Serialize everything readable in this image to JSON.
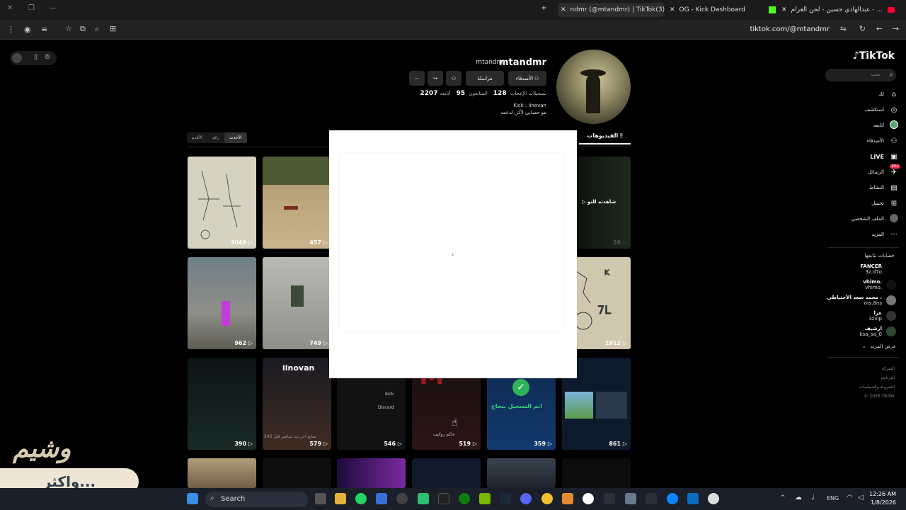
{
  "browser": {
    "tabs": [
      {
        "label": "عبدالهادي حسين - لحن الغرام - ..."
      },
      {
        "label": "OG - Kick Dashboard"
      },
      {
        "label": "ndmr (@mtandmr) | TikTok(3)"
      }
    ],
    "url": "tiktok.com/@mtandmr"
  },
  "sidebar": {
    "logo": "TikTok",
    "search_placeholder": "بحث",
    "items": [
      {
        "label": "لك",
        "icon": "home-icon"
      },
      {
        "label": "استكشف",
        "icon": "compass-icon"
      },
      {
        "label": "أتابعه",
        "icon": "following-avatar-icon"
      },
      {
        "label": "الأصدقاء",
        "icon": "friends-icon"
      },
      {
        "label": "LIVE",
        "icon": "live-icon"
      },
      {
        "label": "الرسائل",
        "icon": "messages-icon",
        "badge": "99+"
      },
      {
        "label": "النشاط",
        "icon": "activity-icon"
      },
      {
        "label": "تحميل",
        "icon": "upload-icon"
      },
      {
        "label": "الملف الشخصي",
        "icon": "profile-icon"
      },
      {
        "label": "المزيد",
        "icon": "more-icon"
      }
    ],
    "following_header": "حسابات تتابعها",
    "following": [
      {
        "name": "FANCER",
        "handle": "3z.d7o"
      },
      {
        "name": "vhimo.",
        "handle": "vhimo."
      },
      {
        "name": "محمد سعد الأحتياطي .",
        "handle": "ms.8ns"
      },
      {
        "name": "عزا",
        "handle": "3zvip"
      },
      {
        "name": "ارشيف",
        "handle": "ksa_sa_0"
      }
    ],
    "show_more": "عرض المزيد",
    "footer": [
      "الشركة",
      "البرنامج",
      "الشروط والسياسات",
      "© 2026 TikTok"
    ]
  },
  "profile": {
    "username": "mtandmr",
    "handle": "mtandmr",
    "buttons": {
      "follow": "الأصدقاء",
      "message": "مراسلة"
    },
    "stats": {
      "following_label": "أتابعه",
      "following": "95",
      "followers_label": "المتابعون",
      "followers": "128",
      "likes_label": "تسجيلات الإعجاب",
      "likes": "2207"
    },
    "bio_line1": "Kick : iinovan",
    "bio_line2": "مو حسابي لأكن لدعمه",
    "tab_videos": "الفيديوهات",
    "sort_tabs": [
      "الأحدث",
      "رائج",
      "الأقدم"
    ],
    "grid_label_watching": "شاهدته للتو",
    "videos": [
      {
        "count": "3049"
      },
      {
        "count": "457"
      },
      {
        "count": "20"
      },
      {
        "count": "962"
      },
      {
        "count": "749"
      },
      {
        "count": "1912"
      },
      {
        "count": "390"
      },
      {
        "count": "579"
      },
      {
        "count": "546"
      },
      {
        "count": "519"
      },
      {
        "count": "359"
      },
      {
        "count": "861"
      }
    ],
    "thumb_texts": {
      "iinovan": "iinovan",
      "kick": "Kick",
      "discord": "Discord",
      "registered": "تم التسجيل بنجاح!",
      "hakim": "حاكم روكيت",
      "live_text": "243 متابع اخر بث مباشر قبل"
    }
  },
  "watermark": {
    "top": "وشيم",
    "bottom": "واكثر..."
  },
  "taskbar": {
    "search": "Search",
    "lang": "ENG",
    "time": "12:26 AM",
    "date": "1/8/2026"
  }
}
